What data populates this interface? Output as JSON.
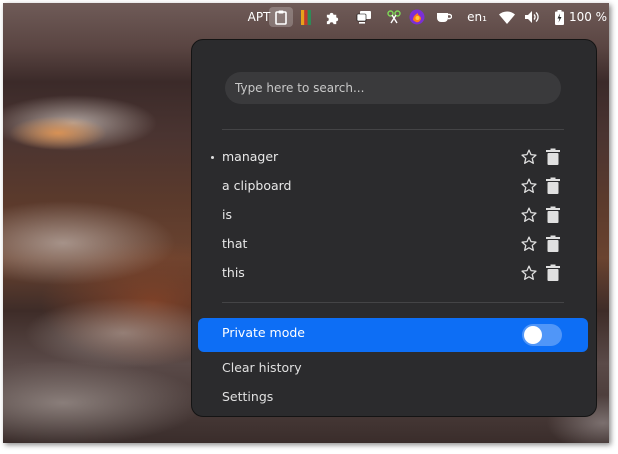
{
  "topbar": {
    "apt_label": "APT",
    "lang_label": "en₁",
    "battery_percent": "100 %",
    "icons": [
      "clipboard-icon",
      "flag-icon",
      "puzzle-extension-icon",
      "display-icon",
      "plant-icon",
      "firefox-icon",
      "coffee-cup-icon",
      "wifi-icon",
      "volume-icon",
      "battery-icon"
    ]
  },
  "clipboard": {
    "search_placeholder": "Type here to search...",
    "entries": [
      {
        "label": "manager",
        "current": true
      },
      {
        "label": "a clipboard",
        "current": false
      },
      {
        "label": "is",
        "current": false
      },
      {
        "label": "that",
        "current": false
      },
      {
        "label": "this",
        "current": false
      }
    ],
    "private_mode_label": "Private mode",
    "private_mode_on": false,
    "clear_history_label": "Clear history",
    "settings_label": "Settings"
  },
  "colors": {
    "popup_bg": "#2b2b2d",
    "accent": "#0d6ef5",
    "search_bg": "#3a3a3c"
  }
}
